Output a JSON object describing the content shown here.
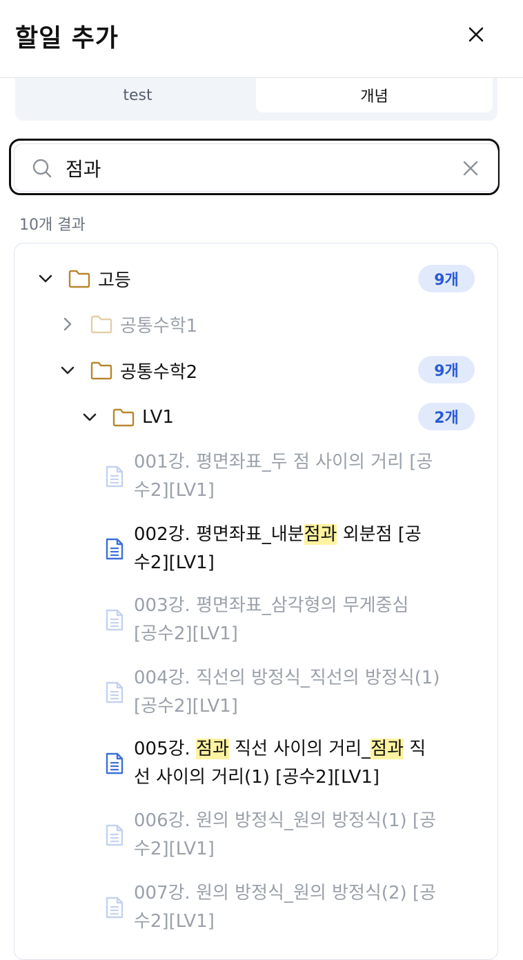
{
  "header": {
    "title": "할일 추가"
  },
  "tabs": [
    {
      "label": "test",
      "active": false
    },
    {
      "label": "개념",
      "active": true
    }
  ],
  "search": {
    "value": "점과"
  },
  "results": {
    "count_label": "10개 결과"
  },
  "tree": {
    "root": {
      "label": "고등",
      "badge": "9개",
      "expanded": true
    },
    "child1": {
      "label": "공통수학1",
      "expanded": false,
      "muted": true
    },
    "child2": {
      "label": "공통수학2",
      "badge": "9개",
      "expanded": true
    },
    "level": {
      "label": "LV1",
      "badge": "2개",
      "expanded": true
    },
    "docs": [
      {
        "line1": "001강. 평면좌표_두 점 사이의 거리 [공",
        "line2": "수2][LV1]",
        "match": false
      },
      {
        "line1_a": "002강. 평면좌표_내분",
        "line1_hl": "점과",
        "line1_b": " 외분점 [공",
        "line2": "수2][LV1]",
        "match": true
      },
      {
        "line1": "003강. 평면좌표_삼각형의 무게중심",
        "line2": "[공수2][LV1]",
        "match": false
      },
      {
        "line1": "004강. 직선의 방정식_직선의 방정식(1)",
        "line2": "[공수2][LV1]",
        "match": false
      },
      {
        "line1_a": "005강. ",
        "line1_hl": "점과",
        "line1_b": " 직선 사이의 거리_",
        "line1_hl2": "점과",
        "line1_c": " 직",
        "line2": "선 사이의 거리(1) [공수2][LV1]",
        "match": true
      },
      {
        "line1": "006강. 원의 방정식_원의 방정식(1) [공",
        "line2": "수2][LV1]",
        "match": false
      },
      {
        "line1": "007강. 원의 방정식_원의 방정식(2) [공",
        "line2": "수2][LV1]",
        "match": false
      }
    ]
  },
  "colors": {
    "accent": "#2a5bd7",
    "badge_bg": "#e1eafb",
    "highlight": "#fdf3a0",
    "folder": "#b8862b",
    "doc_icon_active": "#3b6fd8",
    "doc_icon_dim": "#c3d2f0"
  }
}
